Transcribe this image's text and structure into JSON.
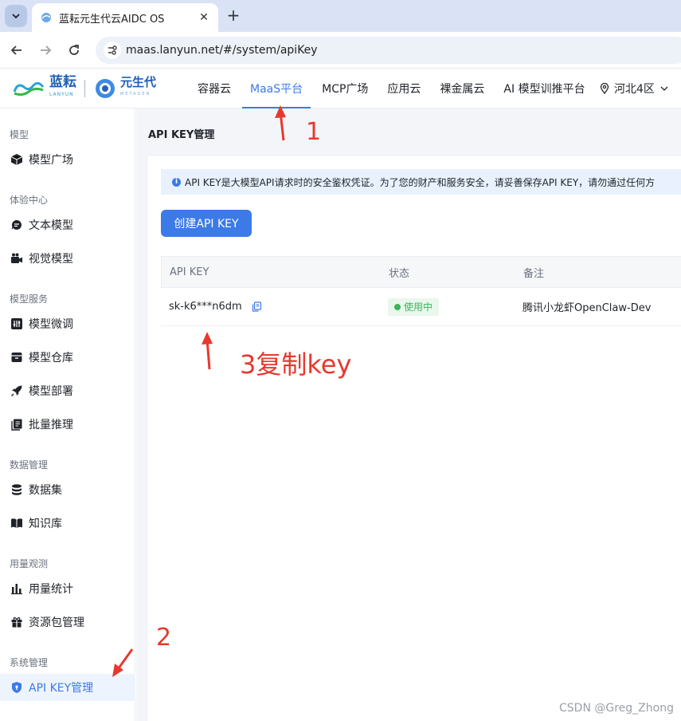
{
  "browser": {
    "tab_title": "蓝耘元生代云AIDC OS",
    "url": "maas.lanyun.net/#/system/apiKey"
  },
  "header": {
    "brand1": "蓝耘",
    "brand1_sub": "LANYUN",
    "brand2": "元生代",
    "brand2_sub": "METAGEN",
    "nav": [
      "容器云",
      "MaaS平台",
      "MCP广场",
      "应用云",
      "裸金属云",
      "AI 模型训推平台"
    ],
    "active_nav": "MaaS平台",
    "region": "河北4区"
  },
  "sidebar": {
    "groups": [
      {
        "title": "模型",
        "items": [
          {
            "label": "模型广场",
            "icon": "cube-icon"
          }
        ]
      },
      {
        "title": "体验中心",
        "items": [
          {
            "label": "文本模型",
            "icon": "chat-icon"
          },
          {
            "label": "视觉模型",
            "icon": "camera-icon"
          }
        ]
      },
      {
        "title": "模型服务",
        "items": [
          {
            "label": "模型微调",
            "icon": "tune-icon"
          },
          {
            "label": "模型仓库",
            "icon": "archive-icon"
          },
          {
            "label": "模型部署",
            "icon": "rocket-icon"
          },
          {
            "label": "批量推理",
            "icon": "copy-stack-icon"
          }
        ]
      },
      {
        "title": "数据管理",
        "items": [
          {
            "label": "数据集",
            "icon": "database-icon"
          },
          {
            "label": "知识库",
            "icon": "book-icon"
          }
        ]
      },
      {
        "title": "用量观测",
        "items": [
          {
            "label": "用量统计",
            "icon": "bar-chart-icon"
          },
          {
            "label": "资源包管理",
            "icon": "gift-icon"
          }
        ]
      },
      {
        "title": "系统管理",
        "items": [
          {
            "label": "API KEY管理",
            "icon": "shield-icon"
          }
        ]
      }
    ],
    "active_item": "API KEY管理"
  },
  "main": {
    "page_title": "API KEY管理",
    "alert": "API KEY是大模型API请求时的安全鉴权凭证。为了您的财产和服务安全，请妥善保存API KEY，请勿通过任何方",
    "create_button": "创建API KEY",
    "table": {
      "headers": [
        "API KEY",
        "状态",
        "备注"
      ],
      "rows": [
        {
          "key": "sk-k6***n6dm",
          "status": "使用中",
          "note": "腾讯小龙虾OpenClaw-Dev"
        }
      ]
    }
  },
  "annotations": {
    "a1": "1",
    "a2": "2",
    "a3": "3复制key",
    "color": "#e8382e"
  },
  "watermark": "CSDN @Greg_Zhong"
}
